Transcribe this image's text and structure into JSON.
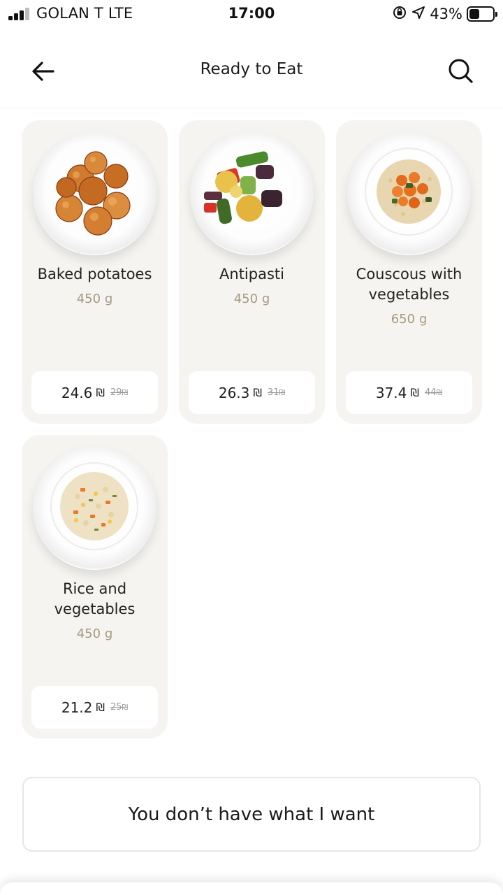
{
  "status_bar": {
    "carrier": "GOLAN T   LTE",
    "time": "17:00",
    "battery_percent": "43%",
    "battery_level": 0.43,
    "icons": [
      "signal-icon",
      "orientation-lock-icon",
      "location-icon",
      "battery-icon"
    ]
  },
  "header": {
    "title": "Ready to Eat",
    "back_icon": "arrow-left-icon",
    "search_icon": "search-icon"
  },
  "products": [
    {
      "name": "Baked potatoes",
      "weight": "450 g",
      "price": "24.6",
      "currency": "₪",
      "old_price": "29",
      "image": "baked-potatoes-image"
    },
    {
      "name": "Antipasti",
      "weight": "450 g",
      "price": "26.3",
      "currency": "₪",
      "old_price": "31",
      "image": "antipasti-image"
    },
    {
      "name": "Couscous with vegetables",
      "weight": "650 g",
      "price": "37.4",
      "currency": "₪",
      "old_price": "44",
      "image": "couscous-image"
    },
    {
      "name": "Rice and vegetables",
      "weight": "450 g",
      "price": "21.2",
      "currency": "₪",
      "old_price": "25",
      "image": "rice-image"
    }
  ],
  "footer": {
    "button_label": "You don’t have what I want"
  },
  "colors": {
    "card_bg": "#f6f4f0",
    "weight_text": "#a69a80",
    "old_price": "#9a9a9a"
  }
}
